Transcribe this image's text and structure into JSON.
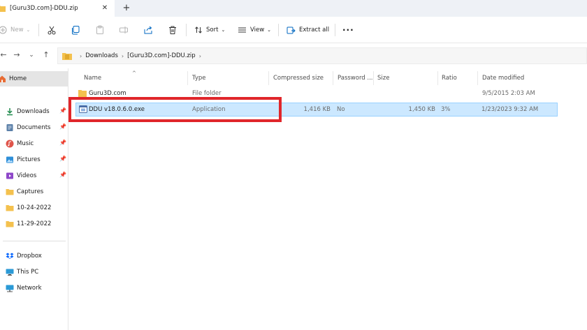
{
  "tab": {
    "title": "[Guru3D.com]-DDU.zip",
    "close": "✕",
    "new": "+"
  },
  "toolbar": {
    "new_label": "New",
    "sort_label": "Sort",
    "view_label": "View",
    "extract_label": "Extract all",
    "more": "···"
  },
  "address": {
    "back": "←",
    "forward": "→",
    "up": "↑",
    "crumbs": [
      "Downloads",
      "[Guru3D.com]-DDU.zip"
    ]
  },
  "sidebar": {
    "home": "Home",
    "items": [
      {
        "label": "Downloads",
        "icon": "download-icon",
        "pinned": true
      },
      {
        "label": "Documents",
        "icon": "document-icon",
        "pinned": true
      },
      {
        "label": "Music",
        "icon": "music-icon",
        "pinned": true
      },
      {
        "label": "Pictures",
        "icon": "pictures-icon",
        "pinned": true
      },
      {
        "label": "Videos",
        "icon": "videos-icon",
        "pinned": true
      },
      {
        "label": "Captures",
        "icon": "folder-icon",
        "pinned": false
      },
      {
        "label": "10-24-2022",
        "icon": "folder-icon",
        "pinned": false
      },
      {
        "label": "11-29-2022",
        "icon": "folder-icon",
        "pinned": false
      }
    ],
    "locations": [
      {
        "label": "Dropbox",
        "icon": "dropbox-icon"
      },
      {
        "label": "This PC",
        "icon": "computer-icon"
      },
      {
        "label": "Network",
        "icon": "network-icon"
      }
    ]
  },
  "columns": {
    "name": "Name",
    "type": "Type",
    "compressed": "Compressed size",
    "password": "Password ...",
    "size": "Size",
    "ratio": "Ratio",
    "date": "Date modified"
  },
  "rows": [
    {
      "name": "Guru3D.com",
      "type": "File folder",
      "compressed": "",
      "password": "",
      "size": "",
      "ratio": "",
      "date": "9/5/2015 2:03 AM",
      "icon": "folder-icon"
    },
    {
      "name": "DDU v18.0.6.0.exe",
      "type": "Application",
      "compressed": "1,416 KB",
      "password": "No",
      "size": "1,450 KB",
      "ratio": "3%",
      "date": "1/23/2023 9:32 AM",
      "icon": "application-icon"
    }
  ],
  "colors": {
    "accent": "#0067c0",
    "selection": "#cce8ff",
    "highlight_box": "#e0262b",
    "folder": "#f4c14e"
  }
}
